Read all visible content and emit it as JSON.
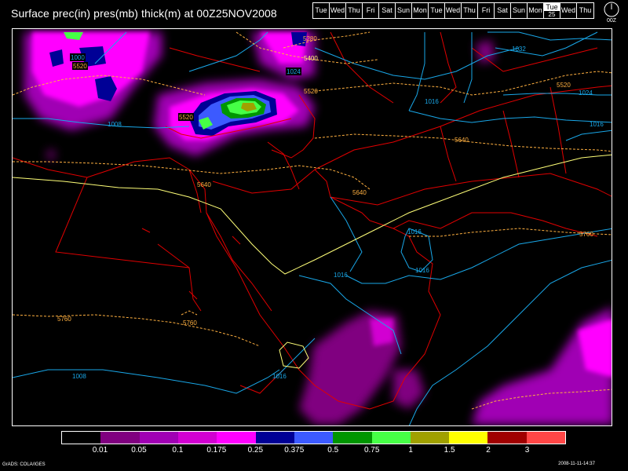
{
  "title": "Surface prec(in) pres(mb) thick(m) at 00Z25NOV2008",
  "day_bar": [
    {
      "label": "Tue"
    },
    {
      "label": "Wed"
    },
    {
      "label": "Thu"
    },
    {
      "label": "Fri"
    },
    {
      "label": "Sat"
    },
    {
      "label": "Sun"
    },
    {
      "label": "Mon"
    },
    {
      "label": "Tue"
    },
    {
      "label": "Wed"
    },
    {
      "label": "Thu"
    },
    {
      "label": "Fri"
    },
    {
      "label": "Sat"
    },
    {
      "label": "Sun"
    },
    {
      "label": "Mon"
    },
    {
      "label": "Tue",
      "sub": "25",
      "current": true
    },
    {
      "label": "Wed"
    },
    {
      "label": "Thu"
    }
  ],
  "clock_label": "00Z",
  "legend": {
    "colors": [
      "#000000",
      "#800080",
      "#a000b4",
      "#d200d2",
      "#ff00ff",
      "#000096",
      "#3c5aff",
      "#009600",
      "#46ff46",
      "#a0a000",
      "#ffff00",
      "#a00000",
      "#ff4646"
    ],
    "ticks": [
      "0.01",
      "0.05",
      "0.1",
      "0.175",
      "0.25",
      "0.375",
      "0.5",
      "0.75",
      "1",
      "1.5",
      "2",
      "3"
    ]
  },
  "map_labels": {
    "pressure": [
      "1000",
      "1008",
      "1016",
      "1024",
      "1032"
    ],
    "thickness": [
      "5280",
      "5400",
      "5520",
      "5640",
      "5760"
    ]
  },
  "footer_left": "GrADS: COLA/IGES",
  "footer_right": "2008-11-11-14:37"
}
